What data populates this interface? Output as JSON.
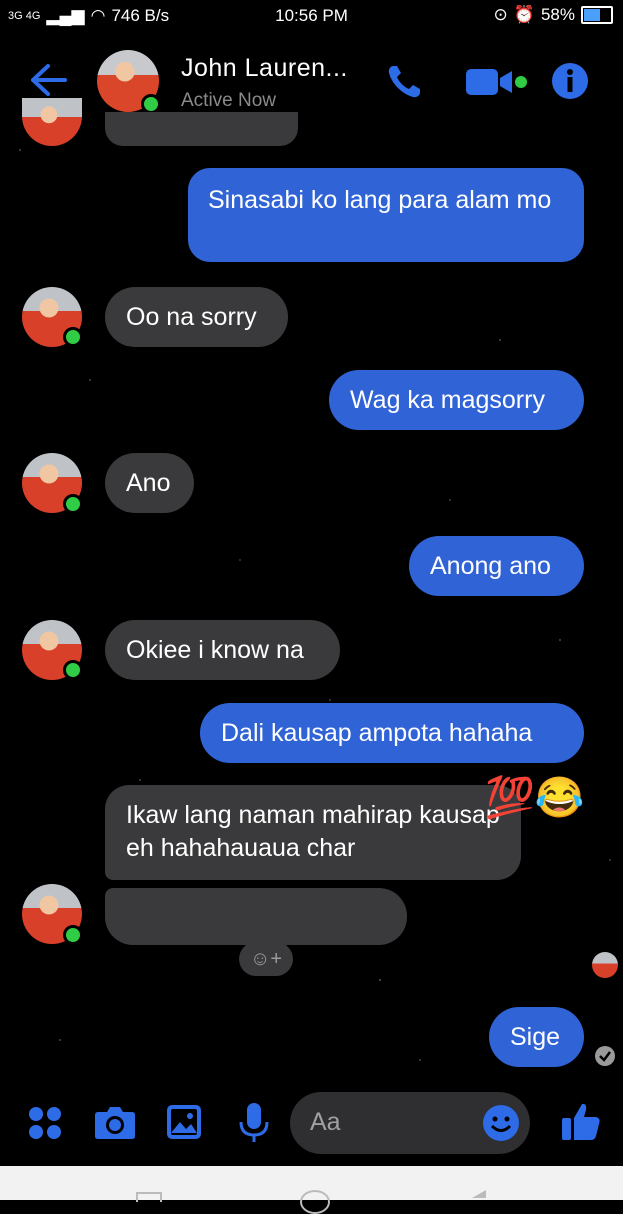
{
  "status_bar": {
    "network": "3G 4G",
    "speed": "746 B/s",
    "time": "10:56 PM",
    "battery": "58%"
  },
  "header": {
    "contact_name": "John Lauren...",
    "status": "Active Now"
  },
  "messages": [
    {
      "from": "me",
      "text": "Sinasabi ko lang para alam mo"
    },
    {
      "from": "them",
      "text": "Oo na sorry"
    },
    {
      "from": "me",
      "text": "Wag ka magsorry"
    },
    {
      "from": "them",
      "text": "Ano"
    },
    {
      "from": "me",
      "text": "Anong ano"
    },
    {
      "from": "them",
      "text": "Okiee i know na"
    },
    {
      "from": "me",
      "text": "Dali kausap ampota hahaha"
    },
    {
      "from": "them",
      "text": "Ikaw lang naman mahirap kausap eh hahahauaua char",
      "emoji": "💯😂"
    },
    {
      "from": "them",
      "text": ""
    },
    {
      "from": "me",
      "text": "Sige"
    }
  ],
  "composer": {
    "placeholder": "Aa"
  },
  "colors": {
    "accent": "#3064d6",
    "received_bubble": "#3a3a3c",
    "online": "#31cc46"
  }
}
